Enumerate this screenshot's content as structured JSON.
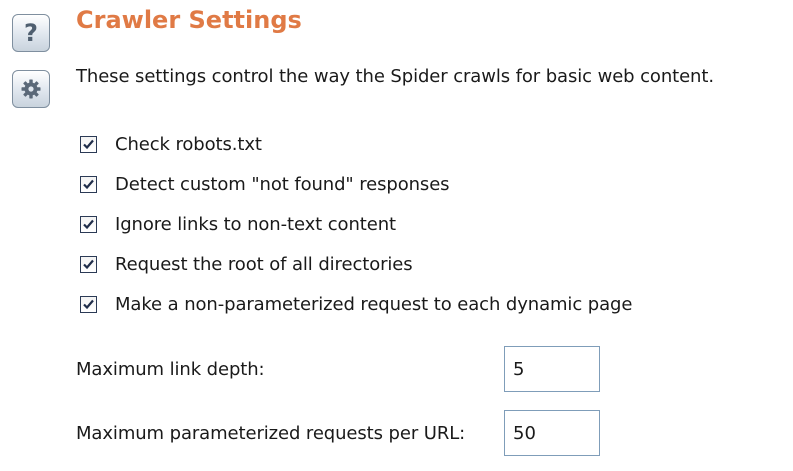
{
  "icons": {
    "help": "help-icon",
    "settings": "gear-icon"
  },
  "help_glyph": "?",
  "title": "Crawler Settings",
  "description": "These settings control the way the Spider crawls for basic web content.",
  "options": [
    {
      "label": "Check robots.txt",
      "checked": true
    },
    {
      "label": "Detect custom \"not found\" responses",
      "checked": true
    },
    {
      "label": "Ignore links to non-text content",
      "checked": true
    },
    {
      "label": "Request the root of all directories",
      "checked": true
    },
    {
      "label": "Make a non-parameterized request to each dynamic page",
      "checked": true
    }
  ],
  "fields": {
    "max_link_depth": {
      "label": "Maximum link depth:",
      "value": "5"
    },
    "max_param_requests": {
      "label": "Maximum parameterized requests per URL:",
      "value": "50"
    }
  },
  "colors": {
    "title": "#e07a45",
    "checkmark": "#1f2d4a"
  }
}
